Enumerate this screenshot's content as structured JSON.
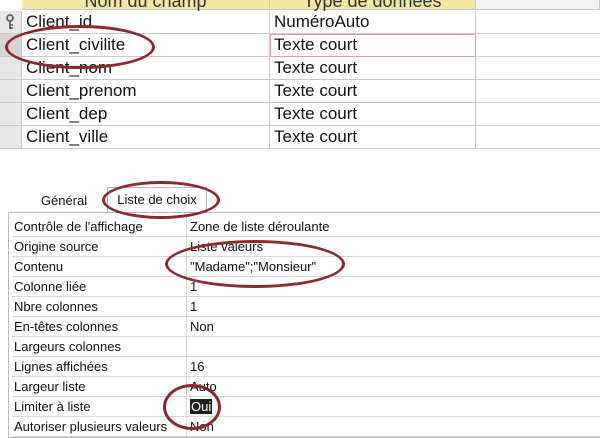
{
  "field_grid": {
    "column_headers": [
      "Nom du champ",
      "Type de données"
    ],
    "rows": [
      {
        "name": "Client_id",
        "type": "NuméroAuto",
        "is_key": true
      },
      {
        "name": "Client_civilite",
        "type": "Texte court"
      },
      {
        "name": "Client_nom",
        "type": "Texte court"
      },
      {
        "name": "Client_prenom",
        "type": "Texte court"
      },
      {
        "name": "Client_dep",
        "type": "Texte court"
      },
      {
        "name": "Client_ville",
        "type": "Texte court"
      }
    ]
  },
  "property_sheet": {
    "tabs": [
      "Général",
      "Liste de choix"
    ],
    "active_tab": "Liste de choix",
    "properties": [
      {
        "label": "Contrôle de l'affichage",
        "value": "Zone de liste déroulante"
      },
      {
        "label": "Origine source",
        "value": "Liste valeurs"
      },
      {
        "label": "Contenu",
        "value": "\"Madame\";\"Monsieur\""
      },
      {
        "label": "Colonne liée",
        "value": "1"
      },
      {
        "label": "Nbre colonnes",
        "value": "1"
      },
      {
        "label": "En-têtes colonnes",
        "value": "Non"
      },
      {
        "label": "Largeurs colonnes",
        "value": ""
      },
      {
        "label": "Lignes affichées",
        "value": "16"
      },
      {
        "label": "Largeur liste",
        "value": "Auto"
      },
      {
        "label": "Limiter à liste",
        "value": "Oui"
      },
      {
        "label": "Autoriser plusieurs valeurs",
        "value": "Non"
      }
    ]
  },
  "colors": {
    "annotation": "#8b2a2e",
    "header_fill": "#f2e6a4",
    "selection": "#1f1f1f"
  },
  "icons": {
    "primary_key": "key-icon"
  }
}
